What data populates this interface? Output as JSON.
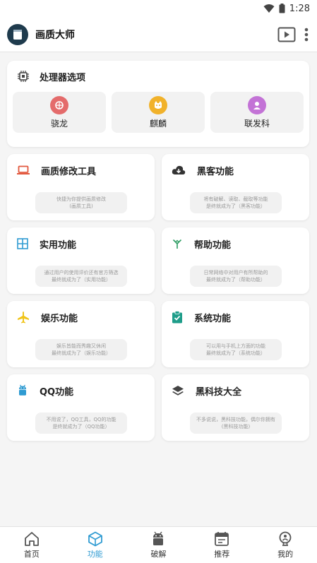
{
  "status_bar": {
    "time": "1:28"
  },
  "app": {
    "title": "画质大师"
  },
  "cpu": {
    "title": "处理器选项",
    "options": [
      {
        "label": "骁龙",
        "icon": "snapdragon-icon",
        "color": "#e46b6b"
      },
      {
        "label": "麒麟",
        "icon": "kirin-icon",
        "color": "#f1b22b"
      },
      {
        "label": "联发科",
        "icon": "mediatek-icon",
        "color": "#c373d6"
      }
    ]
  },
  "features": [
    {
      "title": "画质修改工具",
      "desc": "快捷为你提供画质修改\n(画质工具)",
      "icon": "laptop-icon",
      "color": "#e2583e"
    },
    {
      "title": "黑客功能",
      "desc": "将有破解、读取、截取等功能\n是终就成为了（黑客功能）",
      "icon": "cloud-download-icon",
      "color": "#333333"
    },
    {
      "title": "实用功能",
      "desc": "通过用户的使用评价还有官方筛选\n最终就成为了（实用功能）",
      "icon": "grid-icon",
      "color": "#2f9bd2"
    },
    {
      "title": "帮助功能",
      "desc": "日常网络中对用户有所帮助的\n最终就成为了（帮助功能）",
      "icon": "merge-icon",
      "color": "#2e9d63"
    },
    {
      "title": "娱乐功能",
      "desc": "娱乐皆能而秀趣又休闲\n最终就成为了（娱乐功能）",
      "icon": "airplane-icon",
      "color": "#f0c419"
    },
    {
      "title": "系统功能",
      "desc": "可以用与手机上方面的功能\n最终就成为了（系统功能）",
      "icon": "clipboard-check-icon",
      "color": "#1f9d8a"
    },
    {
      "title": "QQ功能",
      "desc": "不用说了，QQ工具，QQ的功能\n是终就成为了（QQ功能）",
      "icon": "android-icon",
      "color": "#2f9bd2"
    },
    {
      "title": "黑科技大全",
      "desc": "不多说说，黑科技功能，偶尔你拥有\n(黑科技功能)",
      "icon": "layers-icon",
      "color": "#444444"
    }
  ],
  "nav": [
    {
      "label": "首页",
      "icon": "home-icon"
    },
    {
      "label": "功能",
      "icon": "cube-icon",
      "active": true
    },
    {
      "label": "破解",
      "icon": "android-icon"
    },
    {
      "label": "推荐",
      "icon": "calendar-icon"
    },
    {
      "label": "我的",
      "icon": "bulb-person-icon"
    }
  ],
  "accent_color": "#2f9bd2"
}
